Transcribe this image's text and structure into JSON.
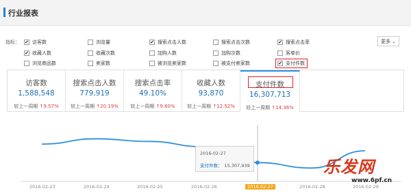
{
  "header": {
    "title": "行业报表"
  },
  "filters": {
    "label": "指标：",
    "more_label": "更多",
    "items": [
      {
        "label": "访客数",
        "checked": true
      },
      {
        "label": "浏览量",
        "checked": false
      },
      {
        "label": "搜索点击人数",
        "checked": true
      },
      {
        "label": "搜索点击次数",
        "checked": false
      },
      {
        "label": "搜索点击率",
        "checked": true
      },
      {
        "label": "收藏人数",
        "checked": true
      },
      {
        "label": "收藏次数",
        "checked": false
      },
      {
        "label": "加购人数",
        "checked": false
      },
      {
        "label": "加购次数",
        "checked": false
      },
      {
        "label": "客单价",
        "checked": false
      },
      {
        "label": "浏览商品数",
        "checked": false
      },
      {
        "label": "卖家数",
        "checked": false
      },
      {
        "label": "被浏览卖家数",
        "checked": false
      },
      {
        "label": "被支付卖家数",
        "checked": false
      },
      {
        "label": "支付件数",
        "checked": true
      }
    ]
  },
  "metrics": [
    {
      "title": "访客数",
      "value": "1,588,548",
      "compare_label": "较上一周期",
      "change": "↑9.57%"
    },
    {
      "title": "搜索点击人数",
      "value": "779,919",
      "compare_label": "较上一周期",
      "change": "↑20.19%"
    },
    {
      "title": "搜索点击率",
      "value": "49.10%",
      "compare_label": "较上一周期",
      "change": "↑9.60%"
    },
    {
      "title": "收藏人数",
      "value": "93,870",
      "compare_label": "较上一周期",
      "change": "↑12.52%"
    },
    {
      "title": "支付件数",
      "value": "16,307,713",
      "compare_label": "较上一周期",
      "change": "↑14.36%"
    }
  ],
  "chart": {
    "dates": [
      "2016-02-23",
      "2016-02-24",
      "2016-02-25",
      "2016-02-26",
      "2016-02-27",
      "2016-02-28",
      "2016-02-29"
    ],
    "active_date": "2016-02-27",
    "tooltip": {
      "date": "2016-02-27",
      "series_label": "支付件数：",
      "value": "15,307,939"
    },
    "line_color": "#2b8ee0",
    "highlight_color": "#f4a81d"
  },
  "chart_data": {
    "type": "line",
    "x": [
      "2016-02-23",
      "2016-02-24",
      "2016-02-25",
      "2016-02-26",
      "2016-02-27",
      "2016-02-28",
      "2016-02-29"
    ],
    "series": [
      {
        "name": "支付件数",
        "values": [
          16700000,
          17100000,
          16900000,
          16500000,
          15307939,
          14900000,
          16200000
        ]
      }
    ],
    "ylim": [
      14000000,
      18000000
    ],
    "grid": false
  },
  "watermark": {
    "text": "乐发网",
    "url": "www.6pf.cn"
  }
}
